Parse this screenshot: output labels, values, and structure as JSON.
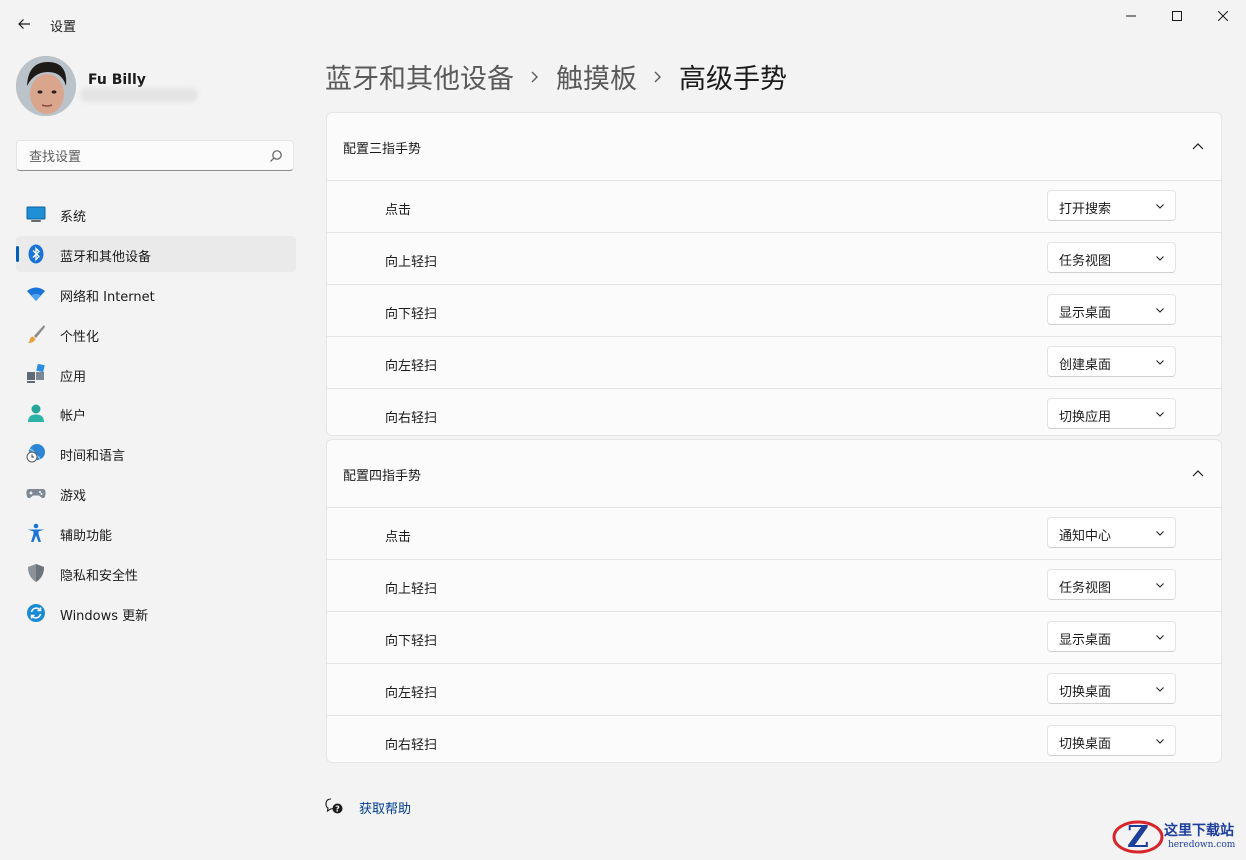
{
  "app": {
    "title": "设置"
  },
  "user": {
    "name": "Fu Billy"
  },
  "search": {
    "placeholder": "查找设置"
  },
  "sidebar": {
    "items": [
      {
        "label": "系统",
        "icon": "system-icon"
      },
      {
        "label": "蓝牙和其他设备",
        "icon": "bluetooth-icon",
        "selected": true
      },
      {
        "label": "网络和 Internet",
        "icon": "wifi-icon"
      },
      {
        "label": "个性化",
        "icon": "brush-icon"
      },
      {
        "label": "应用",
        "icon": "apps-icon"
      },
      {
        "label": "帐户",
        "icon": "account-icon"
      },
      {
        "label": "时间和语言",
        "icon": "time-language-icon"
      },
      {
        "label": "游戏",
        "icon": "gamepad-icon"
      },
      {
        "label": "辅助功能",
        "icon": "accessibility-icon"
      },
      {
        "label": "隐私和安全性",
        "icon": "shield-icon"
      },
      {
        "label": "Windows 更新",
        "icon": "update-icon"
      }
    ]
  },
  "breadcrumb": [
    "蓝牙和其他设备",
    "触摸板",
    "高级手势"
  ],
  "sections": [
    {
      "title": "配置三指手势",
      "rows": [
        {
          "label": "点击",
          "value": "打开搜索"
        },
        {
          "label": "向上轻扫",
          "value": "任务视图"
        },
        {
          "label": "向下轻扫",
          "value": "显示桌面"
        },
        {
          "label": "向左轻扫",
          "value": "创建桌面"
        },
        {
          "label": "向右轻扫",
          "value": "切换应用"
        }
      ]
    },
    {
      "title": "配置四指手势",
      "rows": [
        {
          "label": "点击",
          "value": "通知中心"
        },
        {
          "label": "向上轻扫",
          "value": "任务视图"
        },
        {
          "label": "向下轻扫",
          "value": "显示桌面"
        },
        {
          "label": "向左轻扫",
          "value": "切换桌面"
        },
        {
          "label": "向右轻扫",
          "value": "切换桌面"
        }
      ]
    }
  ],
  "help": {
    "label": "获取帮助"
  },
  "watermark": {
    "text": "这里下载站",
    "sub": "heredown.com"
  },
  "colors": {
    "accent": "#005fb8",
    "link": "#003e92",
    "background": "#f3f3f3",
    "card": "#fbfbfb"
  }
}
